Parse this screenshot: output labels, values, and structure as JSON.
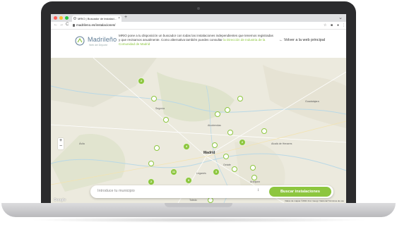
{
  "browser": {
    "tab_title": "MRIO | Buscador de instalaci...",
    "tab_close": "×",
    "new_tab": "+",
    "url": "madrileno.es/instalaciones/",
    "nav": {
      "back": "←",
      "forward": "→",
      "reload": "C"
    },
    "toolbar_icons": [
      "☆",
      "⋮"
    ],
    "traffic_lights": [
      "#ff5f57",
      "#febc2e",
      "#28c840"
    ]
  },
  "site": {
    "logo_text": "Madrileño",
    "logo_sub": "Web del Deporte",
    "info_text": "MRIO pone a tu disposición un buscador con todas las instalaciones independientes que tenemos registradas y que revisamos anualmente. Como alternativa también puedes consultar",
    "info_link": "la Dirección de Industria de la Comunidad de Madrid",
    "back_link": "← Volver a la web principal"
  },
  "map": {
    "zoom_in": "+",
    "zoom_out": "−",
    "places": [
      "Guadalajara",
      "Alcobendas",
      "Madrid",
      "Getafe",
      "Alcalá de Henares",
      "Toledo",
      "Segovia",
      "Ávila",
      "Aranjuez",
      "Leganés"
    ],
    "markers": [
      "2",
      "4",
      "2",
      "11",
      "3",
      "2",
      "3"
    ],
    "search_placeholder": "Introduce tu municipio",
    "search_arrow": "↕",
    "search_button": "Buscar instalaciones",
    "attribution": "Datos de mapas ©2021 Inst. Geogr. Nacional   Términos de uso",
    "google": "Google",
    "colors": {
      "marker": "#8dc63f",
      "map_bg": "#eceade",
      "water": "#b9d8e6"
    }
  }
}
